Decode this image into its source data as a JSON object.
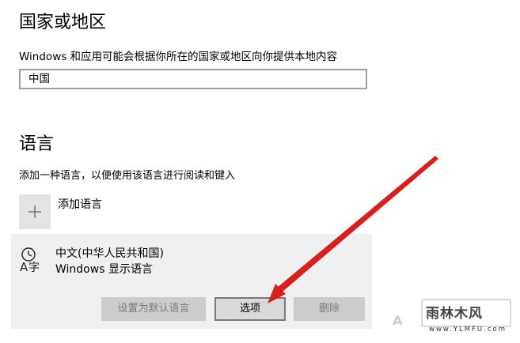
{
  "region": {
    "heading": "国家或地区",
    "description": "Windows 和应用可能会根据你所在的国家或地区向你提供本地内容",
    "country_value": "中国"
  },
  "language": {
    "heading": "语言",
    "description": "添加一种语言，以便使用该语言进行阅读和键入",
    "add_label": "添加语言",
    "item": {
      "name": "中文(中华人民共和国)",
      "subtitle": "Windows 显示语言",
      "icon": "language-clock-icon"
    },
    "buttons": {
      "set_default": "设置为默认语言",
      "options": "选项",
      "remove": "删除"
    }
  },
  "annotation": {
    "arrow_color": "#e02020"
  },
  "watermark": {
    "logo_text": "雨林木风",
    "url": "www.YLMFU.com"
  }
}
